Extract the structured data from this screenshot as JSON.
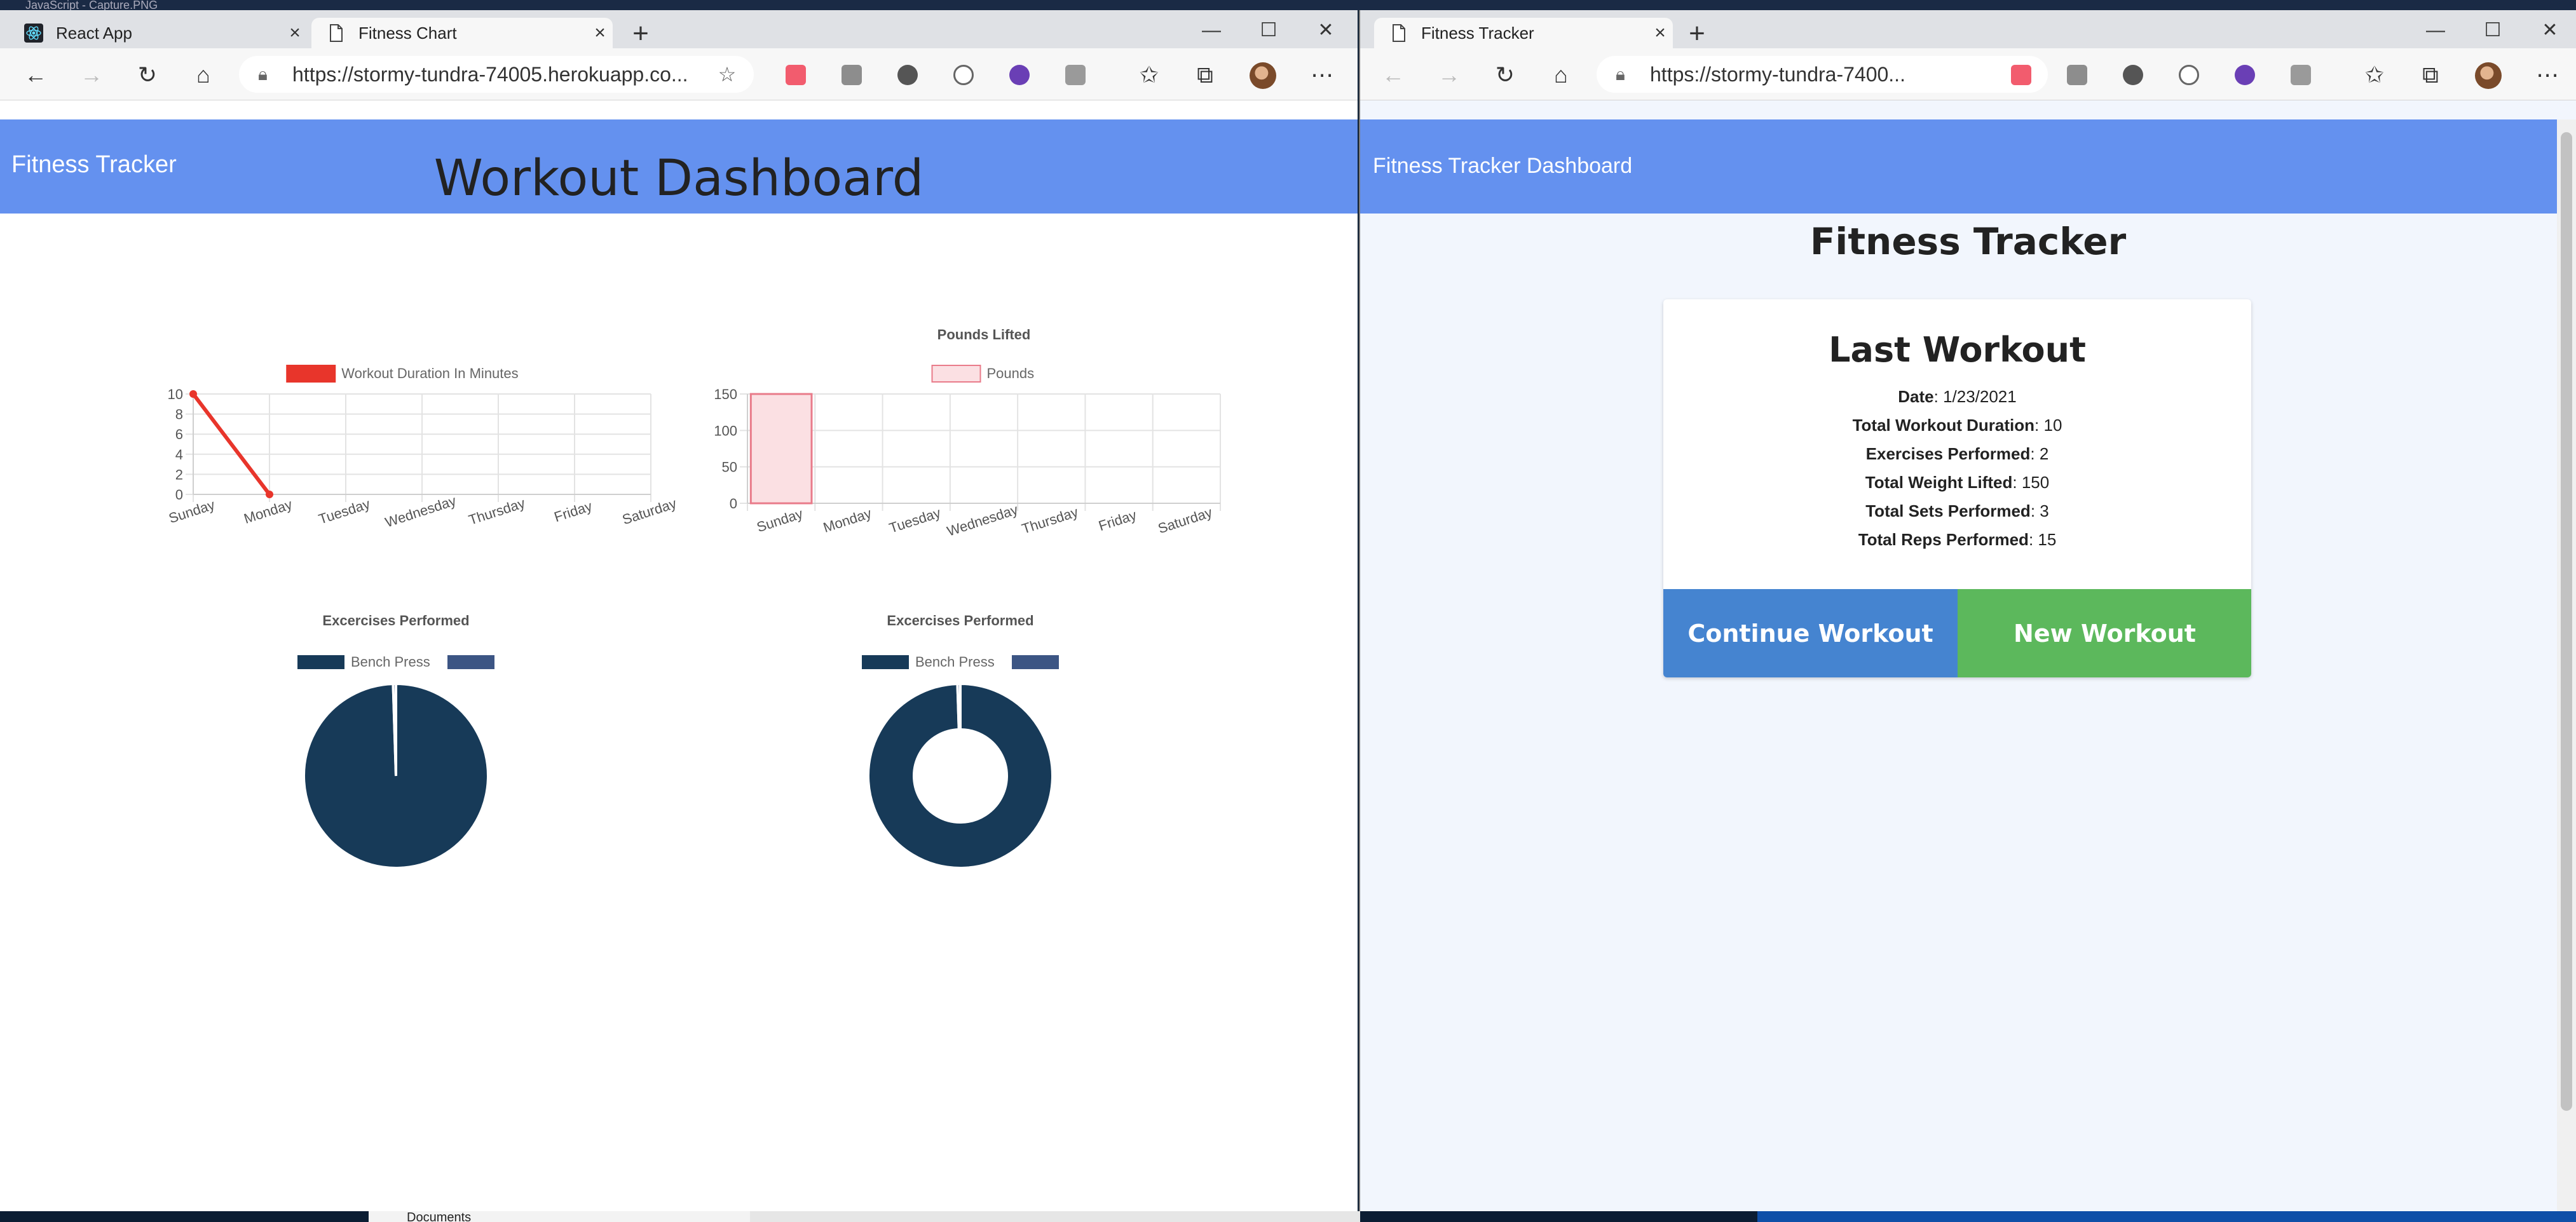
{
  "desktop": {
    "top_text": "JavaScript - Capture.PNG",
    "bottom_text": "Documents"
  },
  "left_window": {
    "tabs": [
      {
        "title": "React App",
        "active": false
      },
      {
        "title": "Fitness Chart",
        "active": true
      }
    ],
    "url": "https://stormy-tundra-74005.herokuapp.co...",
    "navbar_title": "Fitness Tracker",
    "page_title": "Workout Dashboard"
  },
  "right_window": {
    "tabs": [
      {
        "title": "Fitness Tracker",
        "active": true
      }
    ],
    "url": "https://stormy-tundra-7400...",
    "navbar_title": "Fitness Tracker Dashboard",
    "page_title": "Fitness Tracker",
    "card": {
      "heading": "Last Workout",
      "stats": [
        {
          "label": "Date",
          "value": "1/23/2021"
        },
        {
          "label": "Total Workout Duration",
          "value": "10"
        },
        {
          "label": "Exercises Performed",
          "value": "2"
        },
        {
          "label": "Total Weight Lifted",
          "value": "150"
        },
        {
          "label": "Total Sets Performed",
          "value": "3"
        },
        {
          "label": "Total Reps Performed",
          "value": "15"
        }
      ],
      "continue_label": "Continue Workout",
      "new_label": "New Workout"
    }
  },
  "icons": {
    "back": "arrow-left-icon",
    "forward": "arrow-right-icon",
    "refresh": "refresh-icon",
    "home": "home-icon",
    "lock": "lock-icon",
    "favorite": "star-plus-icon",
    "more": "ellipsis-icon"
  },
  "colors": {
    "navbar": "#6491ef",
    "line": "#e8352b",
    "bar_fill": "#fbe0e3",
    "bar_stroke": "#e97b8a",
    "pie_primary": "#173a58",
    "pie_secondary": "#3c5584",
    "continue_button": "#4584d0",
    "new_button": "#5cb85c"
  },
  "chart_data": [
    {
      "type": "line",
      "title": "",
      "legend": [
        "Workout Duration In Minutes"
      ],
      "categories": [
        "Sunday",
        "Monday",
        "Tuesday",
        "Wednesday",
        "Thursday",
        "Friday",
        "Saturday"
      ],
      "series": [
        {
          "name": "Workout Duration In Minutes",
          "points": [
            {
              "x": "Sunday",
              "y": 10
            },
            {
              "x": "Monday",
              "y": 0
            }
          ]
        }
      ],
      "yticks": [
        0,
        2,
        4,
        6,
        8,
        10
      ],
      "ylim": [
        0,
        10
      ],
      "grid": true,
      "legend_position": "top"
    },
    {
      "type": "bar",
      "title": "Pounds Lifted",
      "legend": [
        "Pounds"
      ],
      "categories": [
        "Sunday",
        "Monday",
        "Tuesday",
        "Wednesday",
        "Thursday",
        "Friday",
        "Saturday"
      ],
      "series": [
        {
          "name": "Pounds",
          "values": [
            150,
            null,
            null,
            null,
            null,
            null,
            null
          ]
        }
      ],
      "yticks": [
        0,
        50,
        100,
        150
      ],
      "ylim": [
        0,
        150
      ],
      "grid": true,
      "legend_position": "top"
    },
    {
      "type": "pie",
      "title": "Excercises Performed",
      "legend": [
        "Bench Press",
        ""
      ],
      "values": [
        0.995,
        0.005
      ],
      "legend_position": "top"
    },
    {
      "type": "pie",
      "variant": "doughnut",
      "title": "Excercises Performed",
      "legend": [
        "Bench Press",
        ""
      ],
      "values": [
        0.995,
        0.005
      ],
      "legend_position": "top"
    }
  ]
}
